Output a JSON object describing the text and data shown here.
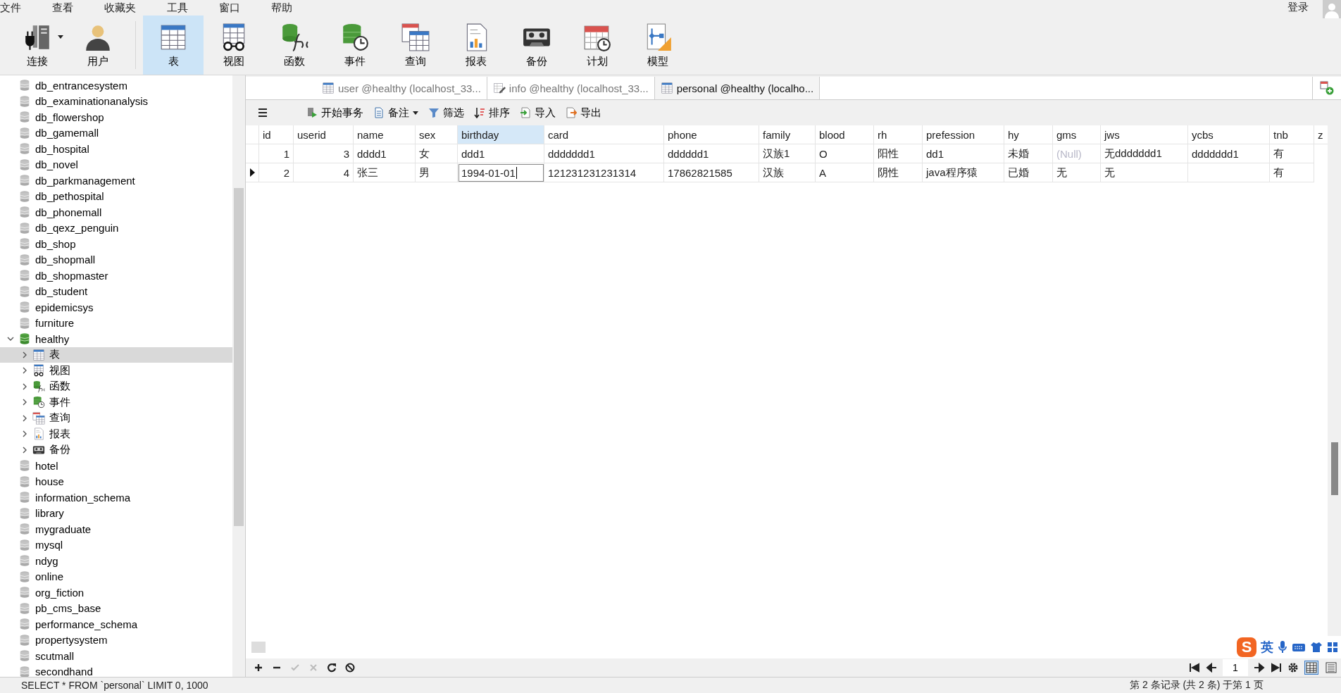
{
  "menu": [
    "文件",
    "查看",
    "收藏夹",
    "工具",
    "窗口",
    "帮助"
  ],
  "login": "登录",
  "toolbar": [
    {
      "kind": "connection",
      "label": "连接",
      "dropdown": true,
      "selected": false
    },
    {
      "kind": "user",
      "label": "用户",
      "selected": false
    },
    {
      "kind": "table",
      "label": "表",
      "selected": true
    },
    {
      "kind": "view",
      "label": "视图",
      "selected": false
    },
    {
      "kind": "function",
      "label": "函数",
      "selected": false
    },
    {
      "kind": "event",
      "label": "事件",
      "selected": false
    },
    {
      "kind": "query",
      "label": "查询",
      "selected": false
    },
    {
      "kind": "report",
      "label": "报表",
      "selected": false
    },
    {
      "kind": "backup",
      "label": "备份",
      "selected": false
    },
    {
      "kind": "schedule",
      "label": "计划",
      "selected": false
    },
    {
      "kind": "model",
      "label": "模型",
      "selected": false
    }
  ],
  "sidebar": {
    "items": [
      {
        "label": "db_entrancesystem",
        "kind": "database",
        "selected": false
      },
      {
        "label": "db_examinationanalysis",
        "kind": "database",
        "selected": false
      },
      {
        "label": "db_flowershop",
        "kind": "database",
        "selected": false
      },
      {
        "label": "db_gamemall",
        "kind": "database",
        "selected": false
      },
      {
        "label": "db_hospital",
        "kind": "database",
        "selected": false
      },
      {
        "label": "db_novel",
        "kind": "database",
        "selected": false
      },
      {
        "label": "db_parkmanagement",
        "kind": "database",
        "selected": false
      },
      {
        "label": "db_pethospital",
        "kind": "database",
        "selected": false
      },
      {
        "label": "db_phonemall",
        "kind": "database",
        "selected": false
      },
      {
        "label": "db_qexz_penguin",
        "kind": "database",
        "selected": false
      },
      {
        "label": "db_shop",
        "kind": "database",
        "selected": false
      },
      {
        "label": "db_shopmall",
        "kind": "database",
        "selected": false
      },
      {
        "label": "db_shopmaster",
        "kind": "database",
        "selected": false
      },
      {
        "label": "db_student",
        "kind": "database",
        "selected": false
      },
      {
        "label": "epidemicsys",
        "kind": "database",
        "selected": false
      },
      {
        "label": "furniture",
        "kind": "database",
        "selected": false
      },
      {
        "label": "healthy",
        "kind": "database_open",
        "selected": false,
        "expanded": true,
        "children": [
          {
            "label": "表",
            "kind": "table",
            "selected": true,
            "expanded": false
          },
          {
            "label": "视图",
            "kind": "view",
            "selected": false,
            "expanded": false
          },
          {
            "label": "函数",
            "kind": "function",
            "selected": false,
            "expanded": false
          },
          {
            "label": "事件",
            "kind": "event",
            "selected": false,
            "expanded": false
          },
          {
            "label": "查询",
            "kind": "query",
            "selected": false,
            "expanded": false
          },
          {
            "label": "报表",
            "kind": "report",
            "selected": false,
            "expanded": false
          },
          {
            "label": "备份",
            "kind": "backup",
            "selected": false,
            "expanded": false
          }
        ]
      },
      {
        "label": "hotel",
        "kind": "database",
        "selected": false
      },
      {
        "label": "house",
        "kind": "database",
        "selected": false
      },
      {
        "label": "information_schema",
        "kind": "database",
        "selected": false
      },
      {
        "label": "library",
        "kind": "database",
        "selected": false
      },
      {
        "label": "mygraduate",
        "kind": "database",
        "selected": false
      },
      {
        "label": "mysql",
        "kind": "database",
        "selected": false
      },
      {
        "label": "ndyg",
        "kind": "database",
        "selected": false
      },
      {
        "label": "online",
        "kind": "database",
        "selected": false
      },
      {
        "label": "org_fiction",
        "kind": "database",
        "selected": false
      },
      {
        "label": "pb_cms_base",
        "kind": "database",
        "selected": false
      },
      {
        "label": "performance_schema",
        "kind": "database",
        "selected": false
      },
      {
        "label": "propertysystem",
        "kind": "database",
        "selected": false
      },
      {
        "label": "scutmall",
        "kind": "database",
        "selected": false
      },
      {
        "label": "secondhand",
        "kind": "database",
        "selected": false
      }
    ]
  },
  "tabs": [
    {
      "kind": "table",
      "label": "user @healthy (localhost_33...",
      "selected": false
    },
    {
      "kind": "edit",
      "label": "info @healthy (localhost_33...",
      "selected": false
    },
    {
      "kind": "table",
      "label": "personal @healthy (localho...",
      "selected": true
    }
  ],
  "actions": [
    {
      "kind": "menu"
    },
    {
      "kind": "transaction",
      "label": "开始事务"
    },
    {
      "kind": "note",
      "label": "备注",
      "dropdown": true
    },
    {
      "kind": "filter",
      "label": "筛选"
    },
    {
      "kind": "sort",
      "label": "排序"
    },
    {
      "kind": "import",
      "label": "导入"
    },
    {
      "kind": "export",
      "label": "导出"
    }
  ],
  "table": {
    "columns": [
      {
        "label": "id",
        "selected": false
      },
      {
        "label": "userid",
        "selected": false
      },
      {
        "label": "name",
        "selected": false
      },
      {
        "label": "sex",
        "selected": false
      },
      {
        "label": "birthday",
        "selected": true
      },
      {
        "label": "card",
        "selected": false
      },
      {
        "label": "phone",
        "selected": false
      },
      {
        "label": "family",
        "selected": false
      },
      {
        "label": "blood",
        "selected": false
      },
      {
        "label": "rh",
        "selected": false
      },
      {
        "label": "prefession",
        "selected": false
      },
      {
        "label": "hy",
        "selected": false
      },
      {
        "label": "gms",
        "selected": false
      },
      {
        "label": "jws",
        "selected": false
      },
      {
        "label": "ycbs",
        "selected": false
      },
      {
        "label": "tnb",
        "selected": false
      },
      {
        "label": "z",
        "selected": false
      }
    ],
    "rows": [
      {
        "current": false,
        "cells": [
          "1",
          "3",
          "dddd1",
          "女",
          "ddd1",
          "ddddddd1",
          "dddddd1",
          "汉族1",
          "O",
          "阳性",
          "dd1",
          "未婚",
          {
            "text": "(Null)",
            "null": true
          },
          "无ddddddd1",
          "ddddddd1",
          "有"
        ]
      },
      {
        "current": true,
        "cells": [
          "2",
          "4",
          "张三",
          "男",
          {
            "text": "1994-01-01",
            "editing": true
          },
          "121231231231314",
          "17862821585",
          "汉族",
          "A",
          "阴性",
          "java程序猿",
          "已婚",
          "无",
          "无",
          null,
          "有"
        ]
      }
    ]
  },
  "record_buttons": [
    {
      "kind": "add",
      "disabled": false
    },
    {
      "kind": "remove",
      "disabled": false
    },
    {
      "kind": "apply",
      "disabled": true
    },
    {
      "kind": "cancel",
      "disabled": true
    },
    {
      "kind": "refresh",
      "disabled": false
    },
    {
      "kind": "stop",
      "disabled": false
    }
  ],
  "ime": {
    "logo": "S",
    "mode": "英"
  },
  "pager": {
    "page": "1",
    "views": [
      {
        "kind": "grid",
        "selected": true
      },
      {
        "kind": "form",
        "selected": false
      }
    ]
  },
  "status_bar": {
    "sql": "SELECT * FROM `personal` LIMIT 0, 1000",
    "records": "第 2 条记录 (共 2 条) 于第 1 页"
  }
}
